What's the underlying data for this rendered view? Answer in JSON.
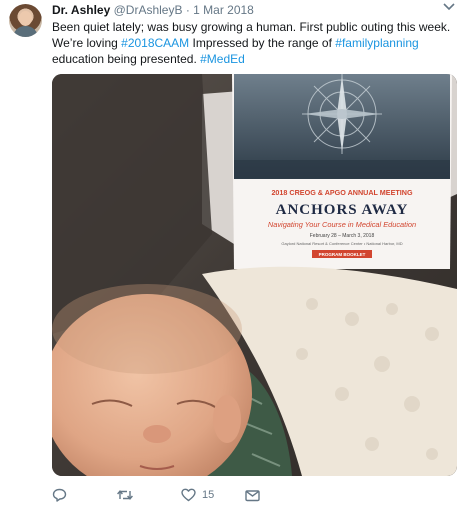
{
  "tweet": {
    "display_name": "Dr. Ashley",
    "handle": "@DrAshleyB",
    "separator": "·",
    "date": "1 Mar 2018",
    "text_segments": [
      {
        "text": "Been quiet lately; was busy growing a human. First public outing this week. We’re loving ",
        "type": "plain"
      },
      {
        "text": "#2018CAAM",
        "type": "hashtag"
      },
      {
        "text": " Impressed by the range of ",
        "type": "plain"
      },
      {
        "text": "#familyplanning",
        "type": "hashtag"
      },
      {
        "text": " education being presented. ",
        "type": "plain"
      },
      {
        "text": "#MedEd",
        "type": "hashtag"
      }
    ],
    "like_count": "15"
  },
  "booklet": {
    "meeting": "2018 CREOG & APGO ANNUAL MEETING",
    "title": "ANCHORS AWAY",
    "subtitle": "Navigating Your Course in Medical Education",
    "dates": "February 28 – March 3, 2018",
    "venue": "Gaylord National Resort & Conference Center • National Harbor, MD",
    "badge": "PROGRAM BOOKLET"
  },
  "icons": {
    "menu": "chevron-down-icon",
    "reply": "reply-icon",
    "retweet": "retweet-icon",
    "like": "heart-icon",
    "message": "envelope-icon"
  },
  "colors": {
    "hashtag": "#1b95e0",
    "muted": "#657786",
    "booklet_red": "#d2452f"
  }
}
